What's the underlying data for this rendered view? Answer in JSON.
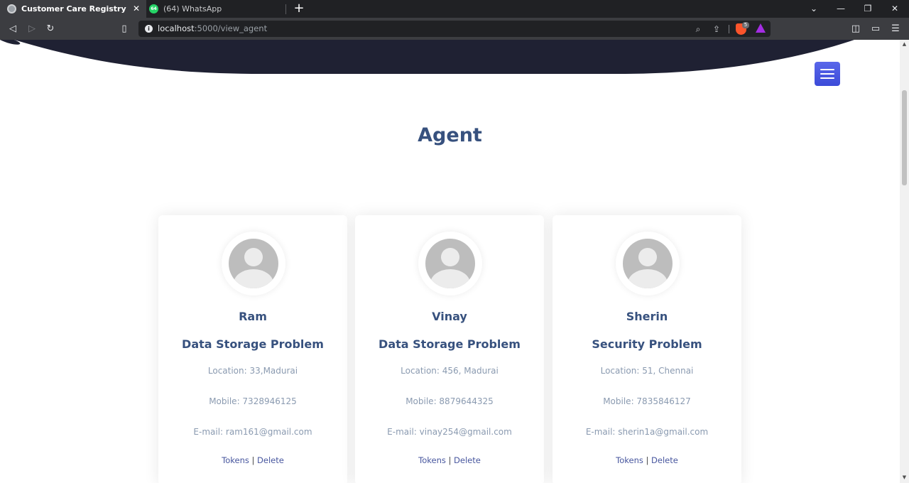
{
  "browser": {
    "tabs": [
      {
        "title": "Customer Care Registry",
        "favicon": "globe-icon",
        "active": true
      },
      {
        "title": "(64) WhatsApp",
        "favicon": "whatsapp-icon",
        "badge": "64",
        "active": false
      }
    ],
    "url_host": "localhost",
    "url_path": ":5000/view_agent",
    "shield_count": "5"
  },
  "page": {
    "section_title": "Agent",
    "accent_color": "#37517e",
    "menu_color": "#4755e0",
    "agents": [
      {
        "name": "Ram",
        "problem": "Data Storage Problem",
        "location": "Location: 33,Madurai",
        "mobile": "Mobile: 7328946125",
        "email": "E-mail: ram161@gmail.com",
        "tokens_label": "Tokens",
        "separator": "|",
        "delete_label": "Delete"
      },
      {
        "name": "Vinay",
        "problem": "Data Storage Problem",
        "location": "Location: 456, Madurai",
        "mobile": "Mobile: 8879644325",
        "email": "E-mail: vinay254@gmail.com",
        "tokens_label": "Tokens",
        "separator": "|",
        "delete_label": "Delete"
      },
      {
        "name": "Sherin",
        "problem": "Security Problem",
        "location": "Location: 51, Chennai",
        "mobile": "Mobile: 7835846127",
        "email": "E-mail: sherin1a@gmail.com",
        "tokens_label": "Tokens",
        "separator": "|",
        "delete_label": "Delete"
      }
    ]
  }
}
